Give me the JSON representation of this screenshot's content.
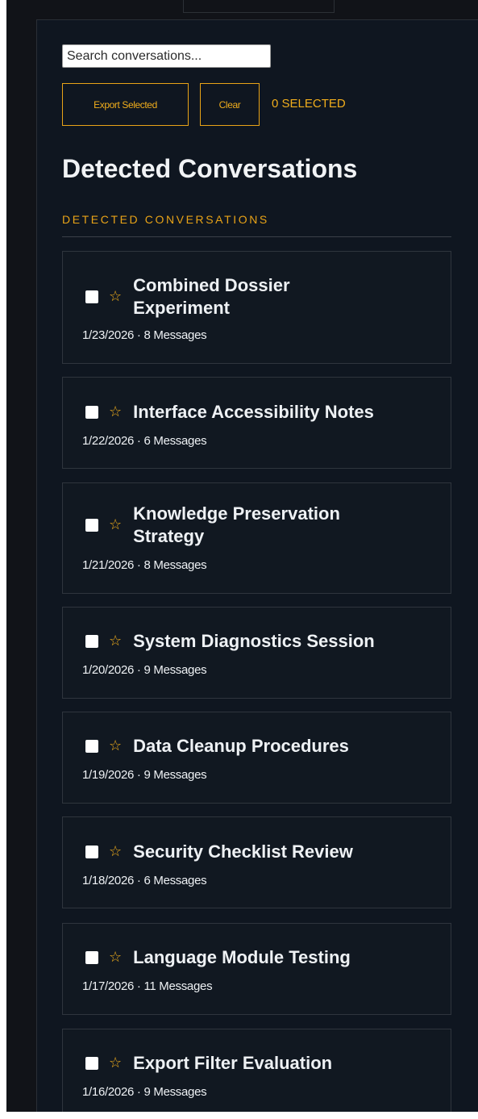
{
  "search": {
    "placeholder": "Search conversations...",
    "value": ""
  },
  "toolbar": {
    "export_label": "Export Selected",
    "clear_label": "Clear",
    "selected_count": "0 SELECTED"
  },
  "page_title": "Detected Conversations",
  "section_heading": "DETECTED CONVERSATIONS",
  "colors": {
    "accent": "#e8a317",
    "background": "#111318",
    "panel": "#0f1620",
    "card": "#111821"
  },
  "star_icon": "☆",
  "conversations": [
    {
      "title": "Combined Dossier Experiment",
      "meta": "1/23/2026 · 8 Messages",
      "checked": false,
      "starred": false
    },
    {
      "title": "Interface Accessibility Notes",
      "meta": "1/22/2026 · 6 Messages",
      "checked": false,
      "starred": false
    },
    {
      "title": "Knowledge Preservation Strategy",
      "meta": "1/21/2026 · 8 Messages",
      "checked": false,
      "starred": false
    },
    {
      "title": "System Diagnostics Session",
      "meta": "1/20/2026 · 9 Messages",
      "checked": false,
      "starred": false
    },
    {
      "title": "Data Cleanup Procedures",
      "meta": "1/19/2026 · 9 Messages",
      "checked": false,
      "starred": false
    },
    {
      "title": "Security Checklist Review",
      "meta": "1/18/2026 · 6 Messages",
      "checked": false,
      "starred": false
    },
    {
      "title": "Language Module Testing",
      "meta": "1/17/2026 · 11 Messages",
      "checked": false,
      "starred": false
    },
    {
      "title": "Export Filter Evaluation",
      "meta": "1/16/2026 · 9 Messages",
      "checked": false,
      "starred": false
    }
  ]
}
